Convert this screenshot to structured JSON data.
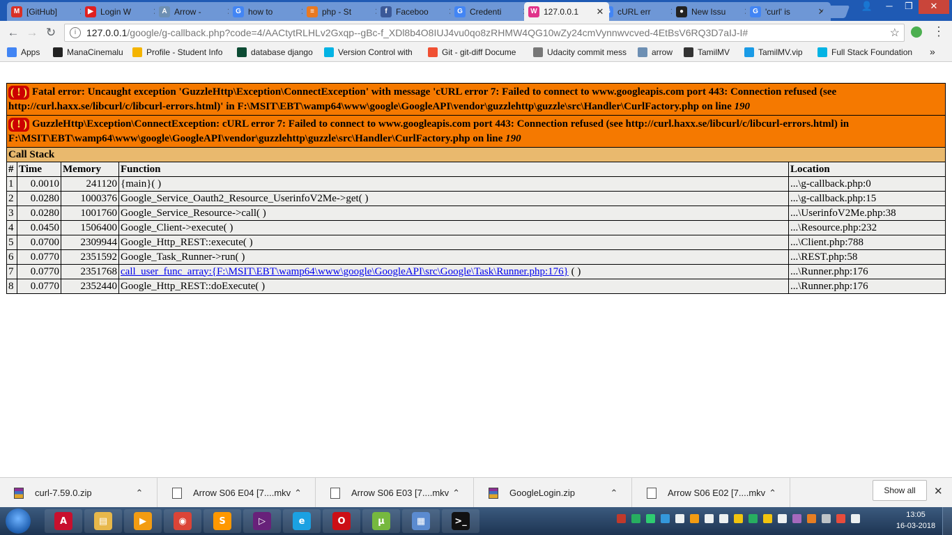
{
  "tabs": [
    {
      "label": "[GitHub]",
      "icon": "gmail-icon",
      "color": "#d93025",
      "glyph": "M"
    },
    {
      "label": "Login W",
      "icon": "youtube-icon",
      "color": "#e02020",
      "glyph": "▶"
    },
    {
      "label": "Arrow -",
      "icon": "arrow-site-icon",
      "color": "#6d8fb3",
      "glyph": "A"
    },
    {
      "label": "how to",
      "icon": "google-icon",
      "color": "#4285f4",
      "glyph": "G"
    },
    {
      "label": "php - St",
      "icon": "stackoverflow-icon",
      "color": "#e87922",
      "glyph": "≡"
    },
    {
      "label": "Faceboo",
      "icon": "facebook-icon",
      "color": "#3b5998",
      "glyph": "f"
    },
    {
      "label": "Credenti",
      "icon": "google-icon",
      "color": "#4285f4",
      "glyph": "G"
    },
    {
      "label": "127.0.0.1",
      "icon": "wampserver-icon",
      "color": "#e0338a",
      "glyph": "W"
    },
    {
      "label": "cURL err",
      "icon": "google-icon",
      "color": "#4285f4",
      "glyph": "G"
    },
    {
      "label": "New Issu",
      "icon": "github-icon",
      "color": "#222222",
      "glyph": "●"
    },
    {
      "label": "'curl' is",
      "icon": "google-icon",
      "color": "#4285f4",
      "glyph": "G"
    }
  ],
  "address": {
    "host": "127.0.0.1",
    "path": "/google/g-callback.php?code=4/AACtytRLHLv2Gxqp--gBc-f_XDl8b4O8IUJ4vu0qo8zRHMW4QG10wZy24cmVynnwvcved-4EtBsV6RQ3D7aIJ-I#"
  },
  "bookmarks": [
    {
      "label": "Apps",
      "icon": "apps-grid-icon",
      "color": "#4285f4"
    },
    {
      "label": "ManaCinemalu",
      "icon": "manacinemalu-icon",
      "color": "#222222"
    },
    {
      "label": "Profile - Student Info",
      "icon": "profile-icon",
      "color": "#f4b400"
    },
    {
      "label": "database django",
      "icon": "django-icon",
      "color": "#0c4b33"
    },
    {
      "label": "Version Control with",
      "icon": "udacity-icon",
      "color": "#02b3e4"
    },
    {
      "label": "Git - git-diff Docume",
      "icon": "git-icon",
      "color": "#f05033"
    },
    {
      "label": "Udacity commit mess",
      "icon": "page-icon",
      "color": "#777777"
    },
    {
      "label": "arrow",
      "icon": "arrow-site-icon",
      "color": "#6d8fb3"
    },
    {
      "label": "TamilMV",
      "icon": "tamilmv-icon",
      "color": "#333333"
    },
    {
      "label": "TamilMV.vip",
      "icon": "tamilmv-vip-icon",
      "color": "#1a9be6"
    },
    {
      "label": "Full Stack Foundation",
      "icon": "udacity-icon",
      "color": "#02b3e4"
    }
  ],
  "bookmarks_overflow": "»",
  "error": {
    "fatal_prefix": "Fatal error: Uncaught exception 'GuzzleHttp\\Exception\\ConnectException' with message 'cURL error 7: Failed to connect to www.googleapis.com port 443: Connection refused (see http://curl.haxx.se/libcurl/c/libcurl-errors.html)' in F:\\MSIT\\EBT\\wamp64\\www\\google\\GoogleAPI\\vendor\\guzzlehttp\\guzzle\\src\\Handler\\CurlFactory.php on line ",
    "fatal_line": "190",
    "exception_prefix": "GuzzleHttp\\Exception\\ConnectException: cURL error 7: Failed to connect to www.googleapis.com port 443: Connection refused (see http://curl.haxx.se/libcurl/c/libcurl-errors.html) in F:\\MSIT\\EBT\\wamp64\\www\\google\\GoogleAPI\\vendor\\guzzlehttp\\guzzle\\src\\Handler\\CurlFactory.php on line ",
    "exception_line": "190",
    "bang": "( ! )"
  },
  "callstack": {
    "title": "Call Stack",
    "columns": [
      "#",
      "Time",
      "Memory",
      "Function",
      "Location"
    ],
    "rows": [
      {
        "n": "1",
        "time": "0.0010",
        "memory": "241120",
        "function": "{main}( )",
        "location": "...\\g-callback.php:0"
      },
      {
        "n": "2",
        "time": "0.0280",
        "memory": "1000376",
        "function": "Google_Service_Oauth2_Resource_UserinfoV2Me->get( )",
        "location": "...\\g-callback.php:15"
      },
      {
        "n": "3",
        "time": "0.0280",
        "memory": "1001760",
        "function": "Google_Service_Resource->call( )",
        "location": "...\\UserinfoV2Me.php:38"
      },
      {
        "n": "4",
        "time": "0.0450",
        "memory": "1506400",
        "function": "Google_Client->execute( )",
        "location": "...\\Resource.php:232"
      },
      {
        "n": "5",
        "time": "0.0700",
        "memory": "2309944",
        "function": "Google_Http_REST::execute( )",
        "location": "...\\Client.php:788"
      },
      {
        "n": "6",
        "time": "0.0770",
        "memory": "2351592",
        "function": "Google_Task_Runner->run( )",
        "location": "...\\REST.php:58"
      },
      {
        "n": "7",
        "time": "0.0770",
        "memory": "2351768",
        "function": "call_user_func_array:{F:\\MSIT\\EBT\\wamp64\\www\\google\\GoogleAPI\\src\\Google\\Task\\Runner.php:176}",
        "function_suffix": " ( )",
        "location": "...\\Runner.php:176"
      },
      {
        "n": "8",
        "time": "0.0770",
        "memory": "2352440",
        "function": "Google_Http_REST::doExecute( )",
        "location": "...\\Runner.php:176"
      }
    ]
  },
  "downloads": [
    {
      "name": "curl-7.59.0.zip",
      "type": "zip"
    },
    {
      "name": "Arrow S06 E04 [7....mkv",
      "type": "video"
    },
    {
      "name": "Arrow S06 E03 [7....mkv",
      "type": "video"
    },
    {
      "name": "GoogleLogin.zip",
      "type": "zip"
    },
    {
      "name": "Arrow S06 E02 [7....mkv",
      "type": "video"
    }
  ],
  "show_all_label": "Show all",
  "taskbar": [
    {
      "icon": "adobe-reader-icon",
      "color": "#c8102e",
      "glyph": "A"
    },
    {
      "icon": "file-explorer-icon",
      "color": "#e8b84a",
      "glyph": "▤"
    },
    {
      "icon": "media-player-icon",
      "color": "#f39c12",
      "glyph": "▶"
    },
    {
      "icon": "chrome-icon",
      "color": "#db4437",
      "glyph": "◉"
    },
    {
      "icon": "sublime-text-icon",
      "color": "#ff9800",
      "glyph": "S"
    },
    {
      "icon": "visual-studio-icon",
      "color": "#68217a",
      "glyph": "▷"
    },
    {
      "icon": "internet-explorer-icon",
      "color": "#1ba1e2",
      "glyph": "e"
    },
    {
      "icon": "opera-icon",
      "color": "#cc0f16",
      "glyph": "O"
    },
    {
      "icon": "utorrent-icon",
      "color": "#76b83f",
      "glyph": "µ"
    },
    {
      "icon": "control-panel-icon",
      "color": "#5b8bd0",
      "glyph": "▦"
    },
    {
      "icon": "command-prompt-icon",
      "color": "#111111",
      "glyph": ">_"
    }
  ],
  "tray_colors": [
    "#c0392b",
    "#27ae60",
    "#2ecc71",
    "#3498db",
    "#ecf0f1",
    "#f39c12",
    "#ecf0f1",
    "#ecf0f1",
    "#f1c40f",
    "#27ae60",
    "#f1c40f",
    "#ecf0f1",
    "#a569bd",
    "#e67e22",
    "#bdc3c7",
    "#e74c3c",
    "#ecf0f1"
  ],
  "clock": {
    "time": "13:05",
    "date": "16-03-2018"
  },
  "colors": {
    "xdebug_orange": "#f57900",
    "xdebug_header": "#e9b96e",
    "xdebug_cell": "#eeeeec",
    "chrome_frame": "#1f5ab4"
  }
}
